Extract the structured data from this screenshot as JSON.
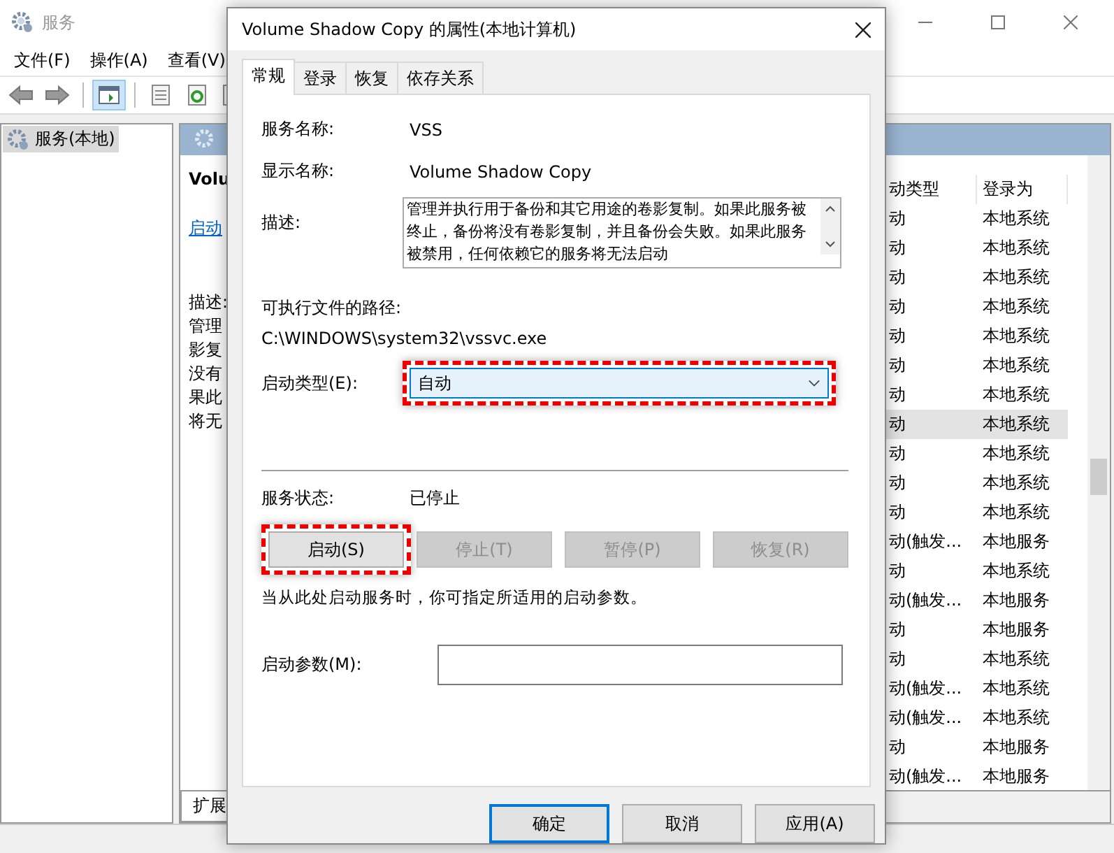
{
  "main_window": {
    "title": "服务",
    "menu": [
      "文件(F)",
      "操作(A)",
      "查看(V)"
    ],
    "tree": [
      {
        "label": "服务(本地)",
        "selected": true
      }
    ],
    "detail": {
      "title": "Volu",
      "link": "启动",
      "desc_label": "描述:",
      "desc_lines": [
        "管理",
        "影复",
        "没有",
        "果此",
        "将无"
      ]
    },
    "columns": [
      "动类型",
      "登录为"
    ],
    "rows": [
      {
        "startup": "动",
        "logon": "本地系统",
        "selected": false
      },
      {
        "startup": "动",
        "logon": "本地系统",
        "selected": false
      },
      {
        "startup": "动",
        "logon": "本地系统",
        "selected": false
      },
      {
        "startup": "动",
        "logon": "本地系统",
        "selected": false
      },
      {
        "startup": "动",
        "logon": "本地系统",
        "selected": false
      },
      {
        "startup": "动",
        "logon": "本地系统",
        "selected": false
      },
      {
        "startup": "动",
        "logon": "本地系统",
        "selected": false
      },
      {
        "startup": "动",
        "logon": "本地系统",
        "selected": true
      },
      {
        "startup": "动",
        "logon": "本地系统",
        "selected": false
      },
      {
        "startup": "动",
        "logon": "本地系统",
        "selected": false
      },
      {
        "startup": "动",
        "logon": "本地系统",
        "selected": false
      },
      {
        "startup": "动(触发...",
        "logon": "本地服务",
        "selected": false
      },
      {
        "startup": "动",
        "logon": "本地系统",
        "selected": false
      },
      {
        "startup": "动(触发...",
        "logon": "本地服务",
        "selected": false
      },
      {
        "startup": "动",
        "logon": "本地服务",
        "selected": false
      },
      {
        "startup": "动",
        "logon": "本地系统",
        "selected": false
      },
      {
        "startup": "动(触发...",
        "logon": "本地系统",
        "selected": false
      },
      {
        "startup": "动(触发...",
        "logon": "本地系统",
        "selected": false
      },
      {
        "startup": "动",
        "logon": "本地服务",
        "selected": false
      },
      {
        "startup": "动(触发...",
        "logon": "本地服务",
        "selected": false
      }
    ],
    "bottom_tabs": [
      {
        "label": "扩展",
        "selected": true
      }
    ]
  },
  "dialog": {
    "title": "Volume Shadow Copy 的属性(本地计算机)",
    "tabs": [
      {
        "label": "常规",
        "selected": true
      },
      {
        "label": "登录",
        "selected": false
      },
      {
        "label": "恢复",
        "selected": false
      },
      {
        "label": "依存关系",
        "selected": false
      }
    ],
    "fields": [
      {
        "label": "服务名称:",
        "value": "VSS"
      },
      {
        "label": "显示名称:",
        "value": "Volume Shadow Copy"
      }
    ],
    "description": {
      "label": "描述:",
      "value": "管理并执行用于备份和其它用途的卷影复制。如果此服务被终止，备份将没有卷影复制，并且备份会失败。如果此服务被禁用，任何依赖它的服务将无法启动"
    },
    "path": {
      "label": "可执行文件的路径:",
      "value": "C:\\WINDOWS\\system32\\vssvc.exe"
    },
    "startup_type": {
      "label": "启动类型(E):",
      "value": "自动",
      "highlighted": true
    },
    "status": {
      "label": "服务状态:",
      "value": "已停止"
    },
    "service_buttons": [
      {
        "label": "启动(S)",
        "disabled": false,
        "highlighted": true
      },
      {
        "label": "停止(T)",
        "disabled": true,
        "highlighted": false
      },
      {
        "label": "暂停(P)",
        "disabled": true,
        "highlighted": false
      },
      {
        "label": "恢复(R)",
        "disabled": true,
        "highlighted": false
      }
    ],
    "hint": "当从此处启动服务时，你可指定所适用的启动参数。",
    "params": {
      "label": "启动参数(M):"
    },
    "buttons": [
      {
        "label": "确定",
        "default": true
      },
      {
        "label": "取消",
        "default": false
      },
      {
        "label": "应用(A)",
        "default": false
      }
    ]
  }
}
